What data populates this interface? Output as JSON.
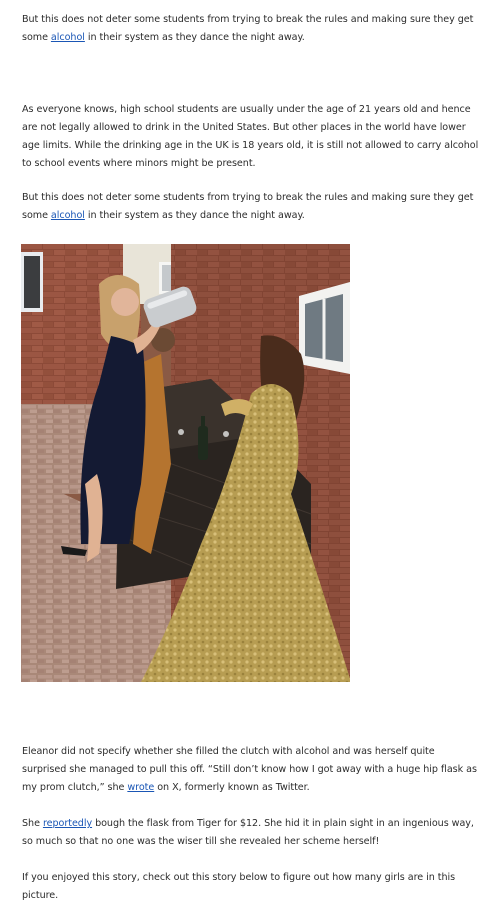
{
  "article": {
    "p1": {
      "before": "But this does not deter some students from trying to break the rules and making sure they get some ",
      "link": "alcohol",
      "after": " in their system as they dance the night away."
    },
    "p2": "As everyone knows, high school students are usually under the age of 21 years old and hence are not legally allowed to drink in the United States. But other places in the world have lower age limits. While the drinking age in the UK is 18 years old, it is still not allowed to carry alcohol to school events where minors might be present.",
    "p3": {
      "before": "But this does not deter some students from trying to break the rules and making sure they get some ",
      "link": "alcohol",
      "after": " in their system as they dance the night away."
    },
    "p4": {
      "before": "Eleanor did not specify whether she filled the clutch with alcohol and was herself quite surprised she managed to pull this off. “Still don’t know how I got away with a huge hip flask as my prom clutch,” she ",
      "link": "wrote",
      "after": " on X, formerly known as Twitter."
    },
    "p5": {
      "before": "She ",
      "link": "reportedly",
      "after": " bough the flask from Tiger for $12. She hid it in plain sight in an ingenious way, so much so that no one was the wiser till she revealed her scheme herself!"
    },
    "p6": "If you enjoyed this story, check out this story below to figure out how many girls are in this picture."
  },
  "colors": {
    "text": "#2c2c2c",
    "link": "#1a56b5",
    "background": "#ffffff"
  }
}
